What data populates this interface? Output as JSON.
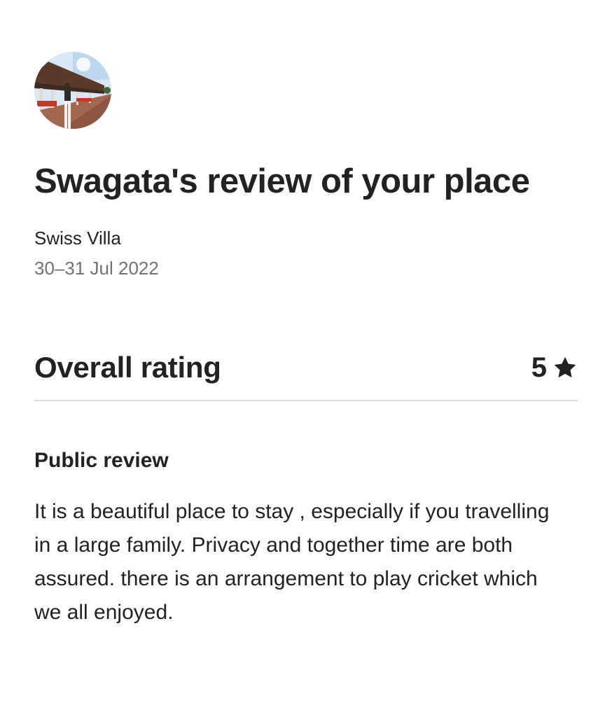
{
  "review": {
    "title": "Swagata's review of your place",
    "listing_name": "Swiss Villa",
    "stay_dates": "30–31 Jul 2022"
  },
  "rating": {
    "label": "Overall rating",
    "value": "5",
    "icon": "star-icon"
  },
  "public_review": {
    "heading": "Public review",
    "text": "It is a beautiful place to stay , especially if you travelling in a large family. Privacy and together time are both assured. there is an arrangement to play cricket which we all enjoyed."
  },
  "colors": {
    "text_primary": "#222222",
    "text_secondary": "#717171",
    "divider": "#dddddd",
    "background": "#ffffff"
  }
}
